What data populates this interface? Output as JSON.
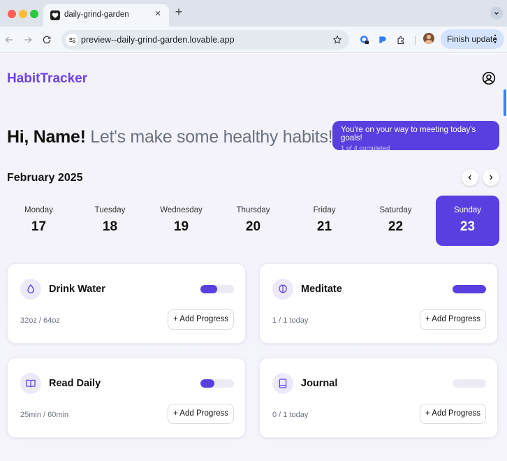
{
  "browser": {
    "tab_title": "daily-grind-garden",
    "tab_close": "×",
    "new_tab": "+",
    "url": "preview--daily-grind-garden.lovable.app",
    "finish_update": "Finish update"
  },
  "header": {
    "brand": "HabitTracker"
  },
  "greeting": {
    "hi": "Hi, Name!",
    "sub": " Let's make some healthy habits!"
  },
  "goal": {
    "message": "You're on your way to meeting today's goals!",
    "count": "1 of 4 completed"
  },
  "calendar": {
    "month": "February 2025",
    "days": [
      {
        "name": "Monday",
        "num": "17"
      },
      {
        "name": "Tuesday",
        "num": "18"
      },
      {
        "name": "Wednesday",
        "num": "19"
      },
      {
        "name": "Thursday",
        "num": "20"
      },
      {
        "name": "Friday",
        "num": "21"
      },
      {
        "name": "Saturday",
        "num": "22"
      },
      {
        "name": "Sunday",
        "num": "23"
      }
    ],
    "selected_day": "Sunday"
  },
  "habits": [
    {
      "title": "Drink Water",
      "progress_text": "32oz / 64oz",
      "progress": 0.5,
      "icon": "droplet-icon",
      "button": "+ Add Progress"
    },
    {
      "title": "Meditate",
      "progress_text": "1 / 1 today",
      "progress": 1.0,
      "icon": "brain-icon",
      "button": "+ Add Progress"
    },
    {
      "title": "Read Daily",
      "progress_text": "25min / 60min",
      "progress": 0.42,
      "icon": "book-open-icon",
      "button": "+ Add Progress"
    },
    {
      "title": "Journal",
      "progress_text": "0 / 1 today",
      "progress": 0,
      "icon": "notebook-icon",
      "button": "+ Add Progress"
    }
  ],
  "colors": {
    "accent": "#5a3fe0",
    "brand": "#6d41e6"
  }
}
